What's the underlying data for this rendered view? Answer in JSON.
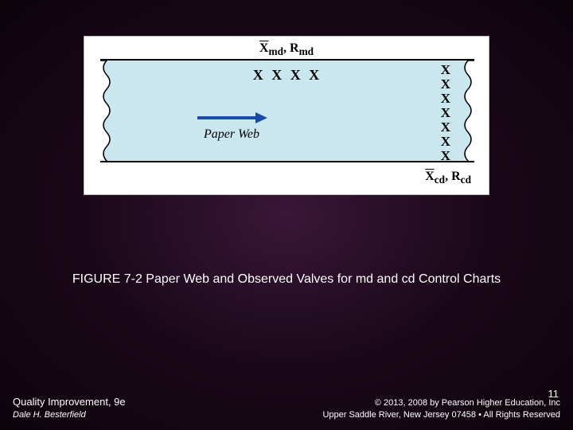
{
  "figure": {
    "top_label_x": "X",
    "top_label_sub": "md",
    "top_label_sep": ", ",
    "top_label_r": "R",
    "top_label_rsub": "md",
    "xxxx_marks": "X X X X",
    "arrow_label": "Paper Web",
    "x_column": [
      "X",
      "X",
      "X",
      "X",
      "X",
      "X",
      "X"
    ],
    "bottom_label_x": "X",
    "bottom_label_sub": "cd",
    "bottom_label_sep": ", ",
    "bottom_label_r": "R",
    "bottom_label_rsub": "cd"
  },
  "caption": "FIGURE 7-2 Paper Web and Observed Valves for md and cd Control Charts",
  "page_number": "11",
  "footer": {
    "book_title": "Quality Improvement, 9e",
    "author": "Dale H. Besterfield",
    "copyright_line1": "© 2013, 2008 by Pearson Higher Education, Inc",
    "copyright_line2": "Upper Saddle River, New Jersey 07458 • All Rights Reserved"
  }
}
